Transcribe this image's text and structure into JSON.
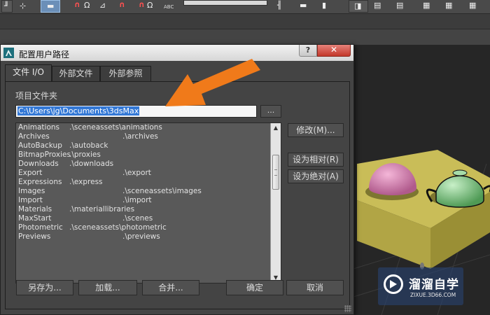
{
  "toolbar": {
    "text_badge": "ABC"
  },
  "dialog": {
    "title": "配置用户路径",
    "tabs": [
      "文件 I/O",
      "外部文件",
      "外部参照"
    ],
    "section_label": "项目文件夹",
    "project_path": "C:\\Users\\jg\\Documents\\3dsMax",
    "browse_label": "...",
    "rows": [
      {
        "name": "Animations",
        "path": ".\\sceneassets\\animations"
      },
      {
        "name": "Archives",
        "path": ".\\archives"
      },
      {
        "name": "AutoBackup",
        "path": ".\\autoback"
      },
      {
        "name": "BitmapProxies",
        "path": ".\\proxies"
      },
      {
        "name": "Downloads",
        "path": ".\\downloads"
      },
      {
        "name": "Export",
        "path": ".\\export"
      },
      {
        "name": "Expressions",
        "path": ".\\express"
      },
      {
        "name": "Images",
        "path": ".\\sceneassets\\images"
      },
      {
        "name": "Import",
        "path": ".\\import"
      },
      {
        "name": "Materials",
        "path": ".\\materiallibraries"
      },
      {
        "name": "MaxStart",
        "path": ".\\scenes"
      },
      {
        "name": "Photometric",
        "path": ".\\sceneassets\\photometric"
      },
      {
        "name": "Previews",
        "path": ".\\previews"
      }
    ],
    "side_buttons": {
      "modify": "修改(M)...",
      "make_relative": "设为相对(R)",
      "make_absolute": "设为绝对(A)"
    },
    "bottom_buttons": {
      "save_as": "另存为...",
      "load": "加载...",
      "merge": "合并...",
      "ok": "确定",
      "cancel": "取消"
    },
    "help_label": "?",
    "close_label": "✕"
  },
  "watermark": {
    "brand": "溜溜自学",
    "url": "ZIXUE.3D66.COM"
  },
  "colors": {
    "selection": "#3378d6",
    "arrow": "#f07a1a",
    "close_button": "#c3382b"
  }
}
